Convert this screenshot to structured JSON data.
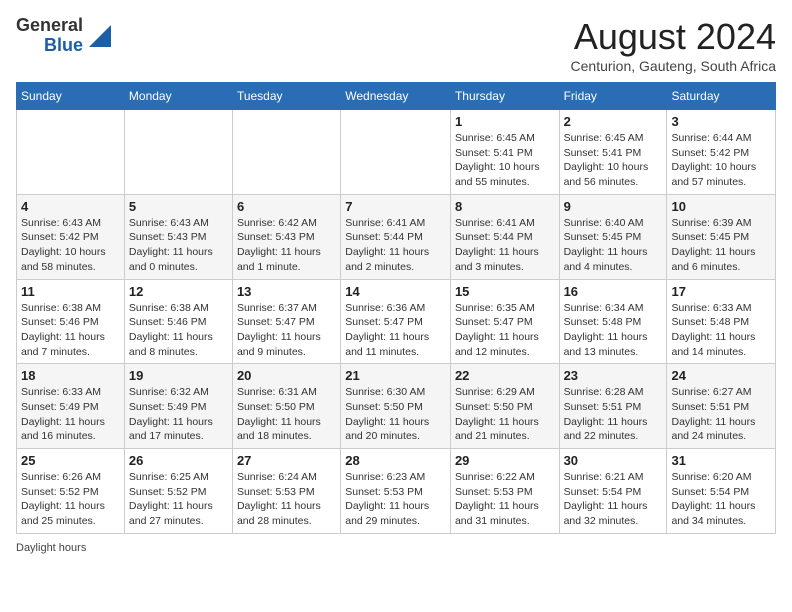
{
  "header": {
    "logo_general": "General",
    "logo_blue": "Blue",
    "month_title": "August 2024",
    "location": "Centurion, Gauteng, South Africa"
  },
  "days_of_week": [
    "Sunday",
    "Monday",
    "Tuesday",
    "Wednesday",
    "Thursday",
    "Friday",
    "Saturday"
  ],
  "weeks": [
    [
      {
        "day": "",
        "info": ""
      },
      {
        "day": "",
        "info": ""
      },
      {
        "day": "",
        "info": ""
      },
      {
        "day": "",
        "info": ""
      },
      {
        "day": "1",
        "info": "Sunrise: 6:45 AM\nSunset: 5:41 PM\nDaylight: 10 hours and 55 minutes."
      },
      {
        "day": "2",
        "info": "Sunrise: 6:45 AM\nSunset: 5:41 PM\nDaylight: 10 hours and 56 minutes."
      },
      {
        "day": "3",
        "info": "Sunrise: 6:44 AM\nSunset: 5:42 PM\nDaylight: 10 hours and 57 minutes."
      }
    ],
    [
      {
        "day": "4",
        "info": "Sunrise: 6:43 AM\nSunset: 5:42 PM\nDaylight: 10 hours and 58 minutes."
      },
      {
        "day": "5",
        "info": "Sunrise: 6:43 AM\nSunset: 5:43 PM\nDaylight: 11 hours and 0 minutes."
      },
      {
        "day": "6",
        "info": "Sunrise: 6:42 AM\nSunset: 5:43 PM\nDaylight: 11 hours and 1 minute."
      },
      {
        "day": "7",
        "info": "Sunrise: 6:41 AM\nSunset: 5:44 PM\nDaylight: 11 hours and 2 minutes."
      },
      {
        "day": "8",
        "info": "Sunrise: 6:41 AM\nSunset: 5:44 PM\nDaylight: 11 hours and 3 minutes."
      },
      {
        "day": "9",
        "info": "Sunrise: 6:40 AM\nSunset: 5:45 PM\nDaylight: 11 hours and 4 minutes."
      },
      {
        "day": "10",
        "info": "Sunrise: 6:39 AM\nSunset: 5:45 PM\nDaylight: 11 hours and 6 minutes."
      }
    ],
    [
      {
        "day": "11",
        "info": "Sunrise: 6:38 AM\nSunset: 5:46 PM\nDaylight: 11 hours and 7 minutes."
      },
      {
        "day": "12",
        "info": "Sunrise: 6:38 AM\nSunset: 5:46 PM\nDaylight: 11 hours and 8 minutes."
      },
      {
        "day": "13",
        "info": "Sunrise: 6:37 AM\nSunset: 5:47 PM\nDaylight: 11 hours and 9 minutes."
      },
      {
        "day": "14",
        "info": "Sunrise: 6:36 AM\nSunset: 5:47 PM\nDaylight: 11 hours and 11 minutes."
      },
      {
        "day": "15",
        "info": "Sunrise: 6:35 AM\nSunset: 5:47 PM\nDaylight: 11 hours and 12 minutes."
      },
      {
        "day": "16",
        "info": "Sunrise: 6:34 AM\nSunset: 5:48 PM\nDaylight: 11 hours and 13 minutes."
      },
      {
        "day": "17",
        "info": "Sunrise: 6:33 AM\nSunset: 5:48 PM\nDaylight: 11 hours and 14 minutes."
      }
    ],
    [
      {
        "day": "18",
        "info": "Sunrise: 6:33 AM\nSunset: 5:49 PM\nDaylight: 11 hours and 16 minutes."
      },
      {
        "day": "19",
        "info": "Sunrise: 6:32 AM\nSunset: 5:49 PM\nDaylight: 11 hours and 17 minutes."
      },
      {
        "day": "20",
        "info": "Sunrise: 6:31 AM\nSunset: 5:50 PM\nDaylight: 11 hours and 18 minutes."
      },
      {
        "day": "21",
        "info": "Sunrise: 6:30 AM\nSunset: 5:50 PM\nDaylight: 11 hours and 20 minutes."
      },
      {
        "day": "22",
        "info": "Sunrise: 6:29 AM\nSunset: 5:50 PM\nDaylight: 11 hours and 21 minutes."
      },
      {
        "day": "23",
        "info": "Sunrise: 6:28 AM\nSunset: 5:51 PM\nDaylight: 11 hours and 22 minutes."
      },
      {
        "day": "24",
        "info": "Sunrise: 6:27 AM\nSunset: 5:51 PM\nDaylight: 11 hours and 24 minutes."
      }
    ],
    [
      {
        "day": "25",
        "info": "Sunrise: 6:26 AM\nSunset: 5:52 PM\nDaylight: 11 hours and 25 minutes."
      },
      {
        "day": "26",
        "info": "Sunrise: 6:25 AM\nSunset: 5:52 PM\nDaylight: 11 hours and 27 minutes."
      },
      {
        "day": "27",
        "info": "Sunrise: 6:24 AM\nSunset: 5:53 PM\nDaylight: 11 hours and 28 minutes."
      },
      {
        "day": "28",
        "info": "Sunrise: 6:23 AM\nSunset: 5:53 PM\nDaylight: 11 hours and 29 minutes."
      },
      {
        "day": "29",
        "info": "Sunrise: 6:22 AM\nSunset: 5:53 PM\nDaylight: 11 hours and 31 minutes."
      },
      {
        "day": "30",
        "info": "Sunrise: 6:21 AM\nSunset: 5:54 PM\nDaylight: 11 hours and 32 minutes."
      },
      {
        "day": "31",
        "info": "Sunrise: 6:20 AM\nSunset: 5:54 PM\nDaylight: 11 hours and 34 minutes."
      }
    ]
  ],
  "legend": {
    "label": "Daylight hours"
  }
}
